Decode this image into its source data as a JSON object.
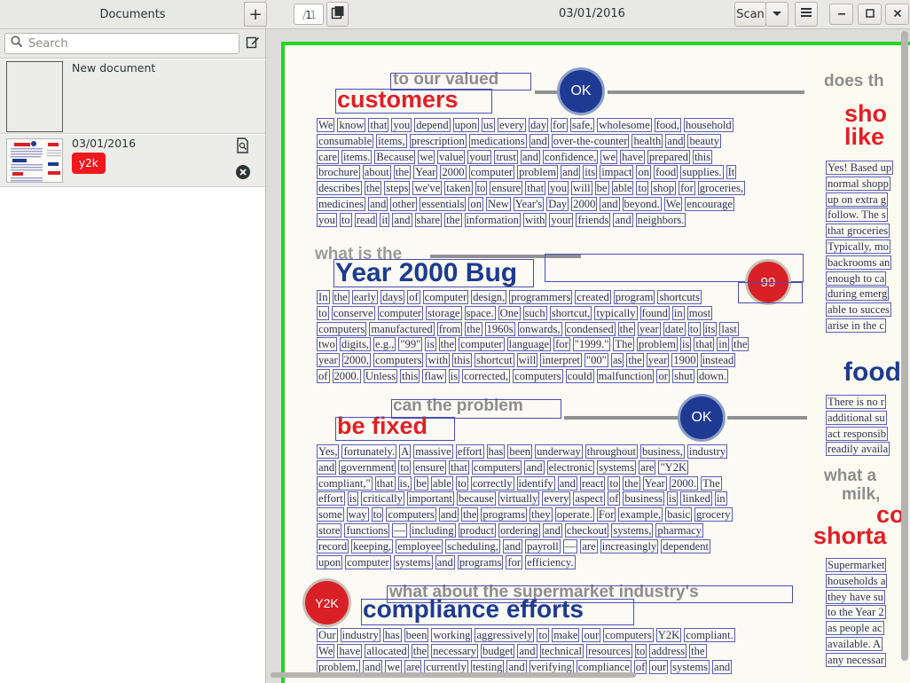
{
  "left_pane": {
    "title": "Documents",
    "search_placeholder": "Search",
    "documents": [
      {
        "title": "New document",
        "labels": []
      },
      {
        "title": "03/01/2016",
        "labels": [
          {
            "text": "y2k",
            "color": "#f0181c"
          }
        ]
      }
    ]
  },
  "toolbar": {
    "add_label": "+",
    "page_current": "1",
    "page_total": "/ 1",
    "date": "03/01/2016",
    "scan_label": "Scan"
  },
  "page": {
    "s1_grey": "to our valued",
    "s1_red": "customers",
    "badge1": "OK",
    "s1_lines": [
      [
        "We",
        "know",
        "that",
        "you",
        "depend",
        "upon",
        "us",
        "every",
        "day",
        "for",
        "safe,",
        "wholesome",
        "food,",
        "household"
      ],
      [
        "consumable",
        "items,",
        "prescription",
        "medications",
        "and",
        "over-the-counter",
        "health",
        "and",
        "beauty"
      ],
      [
        "care",
        "items.",
        "Because",
        "we",
        "value",
        "your",
        "trust",
        "and",
        "confidence,",
        "we",
        "have",
        "prepared",
        "this"
      ],
      [
        "brochure",
        "about",
        "the",
        "Year",
        "2000",
        "computer",
        "problem",
        "and",
        "its",
        "impact",
        "on",
        "food",
        "supplies.",
        "It"
      ],
      [
        "describes",
        "the",
        "steps",
        "we've",
        "taken",
        "to",
        "ensure",
        "that",
        "you",
        "will",
        "be",
        "able",
        "to",
        "shop",
        "for",
        "groceries,"
      ],
      [
        "medicines",
        "and",
        "other",
        "essentials",
        "on",
        "New",
        "Year's",
        "Day",
        "2000",
        "and",
        "beyond.",
        "We",
        "encourage"
      ],
      [
        "you",
        "to",
        "read",
        "it",
        "and",
        "share",
        "the",
        "information",
        "with",
        "your",
        "friends",
        "and",
        "neighbors."
      ]
    ],
    "s2_grey": "what is the",
    "s2_blue": "Year 2000 Bug",
    "badge2": "99",
    "s2_lines": [
      [
        "In",
        "the",
        "early",
        "days",
        "of",
        "computer",
        "design,",
        "programmers",
        "created",
        "program",
        "shortcuts"
      ],
      [
        "to",
        "conserve",
        "computer",
        "storage",
        "space.",
        "One",
        "such",
        "shortcut,",
        "typically",
        "found",
        "in",
        "most"
      ],
      [
        "computers",
        "manufactured",
        "from",
        "the",
        "1960s",
        "onwards,",
        "condensed",
        "the",
        "year",
        "date",
        "to",
        "its",
        "last"
      ],
      [
        "two",
        "digits,",
        "e.g.,",
        "\"99\"",
        "is",
        "the",
        "computer",
        "language",
        "for",
        "\"1999.\"",
        "The",
        "problem",
        "is",
        "that",
        "in",
        "the"
      ],
      [
        "year",
        "2000,",
        "computers",
        "with",
        "this",
        "shortcut",
        "will",
        "interpret",
        "\"00\"",
        "as",
        "the",
        "year",
        "1900",
        "instead"
      ],
      [
        "of",
        "2000.",
        "Unless",
        "this",
        "flaw",
        "is",
        "corrected,",
        "computers",
        "could",
        "malfunction",
        "or",
        "shut",
        "down."
      ]
    ],
    "s3_grey": "can the problem",
    "s3_red": "be fixed",
    "badge3": "OK",
    "s3_lines": [
      [
        "Yes,",
        "fortunately.",
        "A",
        "massive",
        "effort",
        "has",
        "been",
        "underway",
        "throughout",
        "business,",
        "industry"
      ],
      [
        "and",
        "government",
        "to",
        "ensure",
        "that",
        "computers",
        "and",
        "electronic",
        "systems",
        "are",
        "\"Y2K"
      ],
      [
        "compliant,\"",
        "that",
        "is,",
        "be",
        "able",
        "to",
        "correctly",
        "identify",
        "and",
        "react",
        "to",
        "the",
        "Year",
        "2000.",
        "The"
      ],
      [
        "effort",
        "is",
        "critically",
        "important",
        "because",
        "virtually",
        "every",
        "aspect",
        "of",
        "business",
        "is",
        "linked",
        "in"
      ],
      [
        "some",
        "way",
        "to",
        "computers",
        "and",
        "the",
        "programs",
        "they",
        "operate.",
        "For",
        "example,",
        "basic",
        "grocery"
      ],
      [
        "store",
        "functions",
        "—",
        "including",
        "product",
        "ordering",
        "and",
        "checkout",
        "systems,",
        "pharmacy"
      ],
      [
        "record",
        "keeping,",
        "employee",
        "scheduling,",
        "and",
        "payroll",
        "—",
        "are",
        "increasingly",
        "dependent"
      ],
      [
        "upon",
        "computer",
        "systems",
        "and",
        "programs",
        "for",
        "efficiency."
      ]
    ],
    "s4_grey": "what about the supermarket industry's",
    "s4_blue": "compliance efforts",
    "badge4": "Y2K",
    "s4_lines": [
      [
        "Our",
        "industry",
        "has",
        "been",
        "working",
        "aggressively",
        "to",
        "make",
        "our",
        "computers",
        "Y2K",
        "compliant."
      ],
      [
        "We",
        "have",
        "allocated",
        "the",
        "necessary",
        "budget",
        "and",
        "technical",
        "resources",
        "to",
        "address",
        "the"
      ],
      [
        "problem,",
        "and",
        "we",
        "are",
        "currently",
        "testing",
        "and",
        "verifying",
        "compliance",
        "of",
        "our",
        "systems",
        "and"
      ]
    ],
    "r_grey1": "does th",
    "r_red1": "sho",
    "r_red2": "like",
    "r_lines1": [
      "Yes! Based up",
      "normal shopp",
      "up on extra g",
      "follow. The s",
      "that groceries",
      "Typically, mo",
      "backrooms an",
      "enough to ca",
      "during emerg",
      "able to succes",
      "arise in the c"
    ],
    "r_blue": "food",
    "r_lines2": [
      "There is no r",
      "additional su",
      "act responsib",
      "readily availa"
    ],
    "r_grey2": "what a",
    "r_grey3": "milk,",
    "r_red3": "co",
    "r_red4": "shorta",
    "r_lines3": [
      "Supermarket",
      "households a",
      "they have su",
      "to the Year 2",
      "as people ac",
      "available. A",
      "any necessar"
    ]
  }
}
